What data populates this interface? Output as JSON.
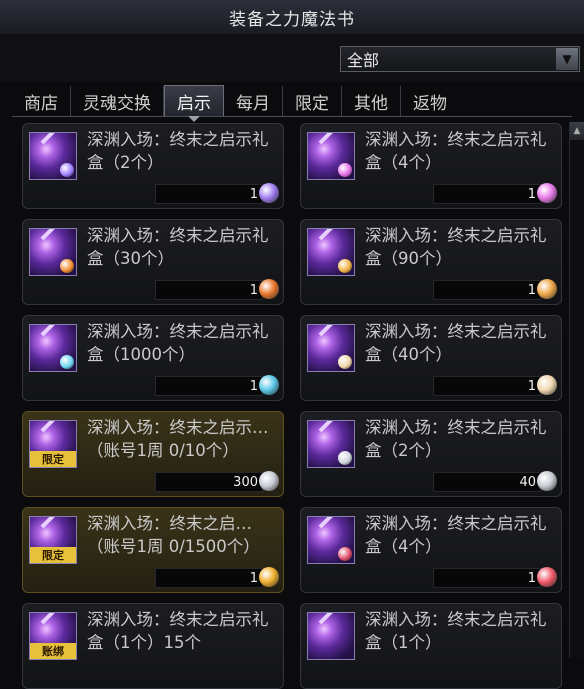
{
  "window": {
    "title": "装备之力魔法书"
  },
  "filter": {
    "selected": "全部"
  },
  "tabs": [
    {
      "label": "商店"
    },
    {
      "label": "灵魂交换"
    },
    {
      "label": "启示"
    },
    {
      "label": "每月"
    },
    {
      "label": "限定"
    },
    {
      "label": "其他"
    },
    {
      "label": "返物"
    }
  ],
  "active_tab": "启示",
  "items": [
    {
      "name": "深渊入场：终末之启示礼盒（2个）",
      "qty": "1",
      "currency_icon": "purple-orb-icon",
      "currency_color": "#a07cf0",
      "gem_color": "#9b7cff",
      "badge": ""
    },
    {
      "name": "深渊入场：终末之启示礼盒（4个）",
      "qty": "1",
      "currency_icon": "pink-orb-icon",
      "currency_color": "#e67ae6",
      "gem_color": "#e36de8",
      "badge": ""
    },
    {
      "name": "深渊入场：终末之启示礼盒（30个）",
      "qty": "1",
      "currency_icon": "orange-orb-icon",
      "currency_color": "#e8782c",
      "gem_color": "#f08a2a",
      "badge": ""
    },
    {
      "name": "深渊入场：终末之启示礼盒（90个）",
      "qty": "1",
      "currency_icon": "gold-orb-icon",
      "currency_color": "#f0a84a",
      "gem_color": "#f0b040",
      "badge": ""
    },
    {
      "name": "深渊入场：终末之启示礼盒（1000个）",
      "qty": "1",
      "currency_icon": "cyan-orb-icon",
      "currency_color": "#5cc8e8",
      "gem_color": "#6ad4f0",
      "badge": ""
    },
    {
      "name": "深渊入场：终末之启示礼盒（40个）",
      "qty": "1",
      "currency_icon": "cream-orb-icon",
      "currency_color": "#f0d8b0",
      "gem_color": "#f0d6a8",
      "badge": ""
    },
    {
      "name": "深渊入场：终末之启示…（账号1周 0/10个）",
      "qty": "300",
      "currency_icon": "silver-coin-icon",
      "currency_color": "#c8ccd4",
      "gem_color": "",
      "badge": "限定"
    },
    {
      "name": "深渊入场：终末之启示礼盒（2个）",
      "qty": "40",
      "currency_icon": "silver-coin-icon",
      "currency_color": "#c8ccd4",
      "gem_color": "#cfd3db",
      "badge": ""
    },
    {
      "name": "深渊入场：终末之启…（账号1周 0/1500个）",
      "qty": "1",
      "currency_icon": "gold-ring-icon",
      "currency_color": "#f0b030",
      "gem_color": "",
      "badge": "限定"
    },
    {
      "name": "深渊入场：终末之启示礼盒（4个）",
      "qty": "1",
      "currency_icon": "red-orb-icon",
      "currency_color": "#f05a6a",
      "gem_color": "#e04a6a",
      "badge": ""
    },
    {
      "name": "深渊入场：终末之启示礼盒（1个）15个",
      "qty": "",
      "currency_icon": "",
      "currency_color": "",
      "gem_color": "",
      "badge": "账绑"
    },
    {
      "name": "深渊入场：终末之启示礼盒（1个）",
      "qty": "",
      "currency_icon": "",
      "currency_color": "",
      "gem_color": "",
      "badge": ""
    }
  ]
}
